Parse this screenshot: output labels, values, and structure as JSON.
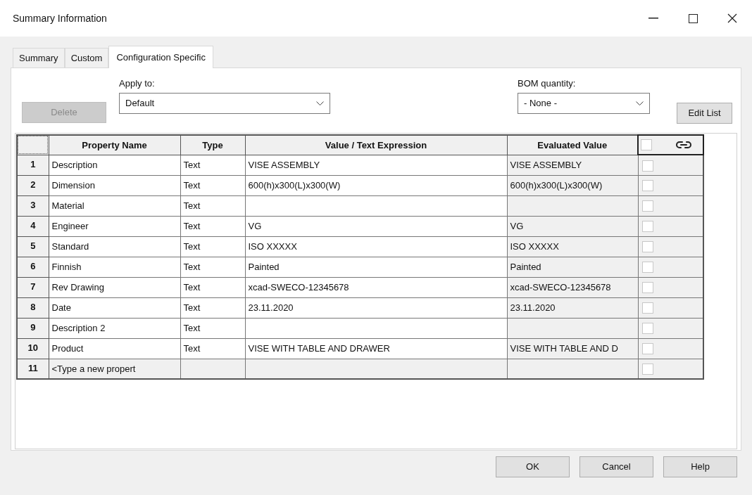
{
  "window": {
    "title": "Summary Information"
  },
  "tabs": [
    {
      "label": "Summary",
      "selected": false
    },
    {
      "label": "Custom",
      "selected": false
    },
    {
      "label": "Configuration Specific",
      "selected": true
    }
  ],
  "toolbar": {
    "delete_button": {
      "label": "Delete",
      "disabled": true
    },
    "apply_to": {
      "label": "Apply to:",
      "value": "Default"
    },
    "bom_quantity": {
      "label": "BOM quantity:",
      "value": "- None -"
    },
    "edit_list_button": {
      "label": "Edit List"
    }
  },
  "table": {
    "columns": [
      "Property Name",
      "Type",
      "Value / Text Expression",
      "Evaluated Value"
    ],
    "header_checkbox": {
      "checked": false
    },
    "rows": [
      {
        "kind": "property",
        "number": "1",
        "name": "Description",
        "type": "Text",
        "value": "VISE ASSEMBLY",
        "evaluated": "VISE ASSEMBLY",
        "checked": false
      },
      {
        "kind": "property",
        "number": "2",
        "name": "Dimension",
        "type": "Text",
        "value": "600(h)x300(L)x300(W)",
        "evaluated": "600(h)x300(L)x300(W)",
        "checked": false
      },
      {
        "kind": "property",
        "number": "3",
        "name": "Material",
        "type": "Text",
        "checked": false
      },
      {
        "kind": "property",
        "number": "4",
        "name": "Engineer",
        "type": "Text",
        "value": "VG",
        "evaluated": "VG",
        "checked": false
      },
      {
        "kind": "property",
        "number": "5",
        "name": "Standard",
        "type": "Text",
        "value": "ISO XXXXX",
        "evaluated": "ISO XXXXX",
        "checked": false
      },
      {
        "kind": "property",
        "number": "6",
        "name": "Finnish",
        "type": "Text",
        "value": "Painted",
        "evaluated": "Painted",
        "checked": false
      },
      {
        "kind": "property",
        "number": "7",
        "name": "Rev Drawing",
        "type": "Text",
        "value": "xcad-SWECO-12345678",
        "evaluated": "xcad-SWECO-12345678",
        "checked": false
      },
      {
        "kind": "property",
        "number": "8",
        "name": "Date",
        "type": "Text",
        "value": "23.11.2020",
        "evaluated": "23.11.2020",
        "checked": false
      },
      {
        "kind": "property",
        "number": "9",
        "name": "Description 2",
        "type": "Text",
        "checked": false
      },
      {
        "kind": "property",
        "number": "10",
        "name": "Product",
        "type": "Text",
        "value": "VISE WITH TABLE AND DRAWER",
        "evaluated": "VISE WITH TABLE AND D",
        "checked": false
      },
      {
        "kind": "new",
        "number": "11",
        "name": "<Type a new propert",
        "checked": false
      }
    ]
  },
  "buttons": [
    "OK",
    "Cancel",
    "Help"
  ]
}
